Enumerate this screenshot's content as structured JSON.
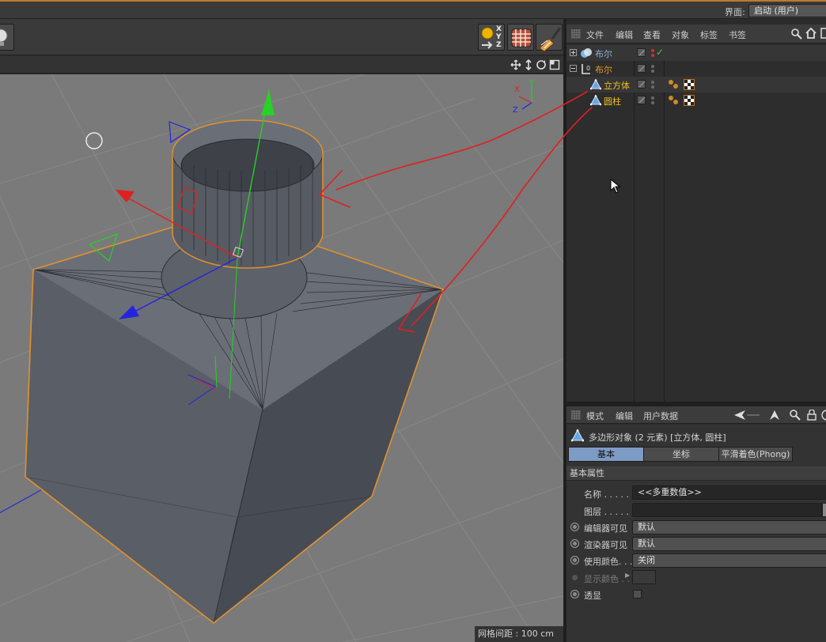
{
  "topbar": {
    "interface_label": "界面:",
    "interface_value": "启动 (用户)"
  },
  "viewport": {
    "grid_spacing": "网格间距 : 100 cm",
    "axis_x": "X",
    "axis_y": "Y",
    "axis_z": "Z"
  },
  "toolbar": {
    "xyz_label": "X Y Z"
  },
  "object_manager": {
    "menu": [
      "文件",
      "编辑",
      "查看",
      "对象",
      "标签",
      "书签"
    ],
    "objects": [
      {
        "name": "布尔",
        "color": "#8fb0d8",
        "icon": "boole-icon"
      },
      {
        "name": "布尔",
        "color": "#e2992a",
        "icon": "null-icon"
      },
      {
        "name": "立方体",
        "color": "#f0c020",
        "icon": "polygon-icon"
      },
      {
        "name": "圆柱",
        "color": "#f0c020",
        "icon": "polygon-icon"
      }
    ]
  },
  "attribute_manager": {
    "menu": [
      "模式",
      "编辑",
      "用户数据"
    ],
    "title": "多边形对象 (2 元素) [立方体, 圆柱]",
    "tabs": [
      "基本",
      "坐标",
      "平滑着色(Phong)"
    ],
    "active_tab": "基本",
    "section": "基本属性",
    "properties": [
      {
        "label": "名称 . . . . .",
        "value": "<<多重数值>>"
      },
      {
        "label": "图层 . . . . .",
        "value": ""
      },
      {
        "label": "编辑器可见",
        "value": "默认"
      },
      {
        "label": "渲染器可见",
        "value": "默认"
      },
      {
        "label": "使用颜色. . .",
        "value": "关闭"
      },
      {
        "label": "显示颜色 . .",
        "value": ""
      },
      {
        "label": "透显",
        "value": ""
      }
    ]
  },
  "colors": {
    "accent_orange": "#e0922e",
    "selection_blue": "#7d9bc5",
    "annotation_red": "#e02020"
  }
}
